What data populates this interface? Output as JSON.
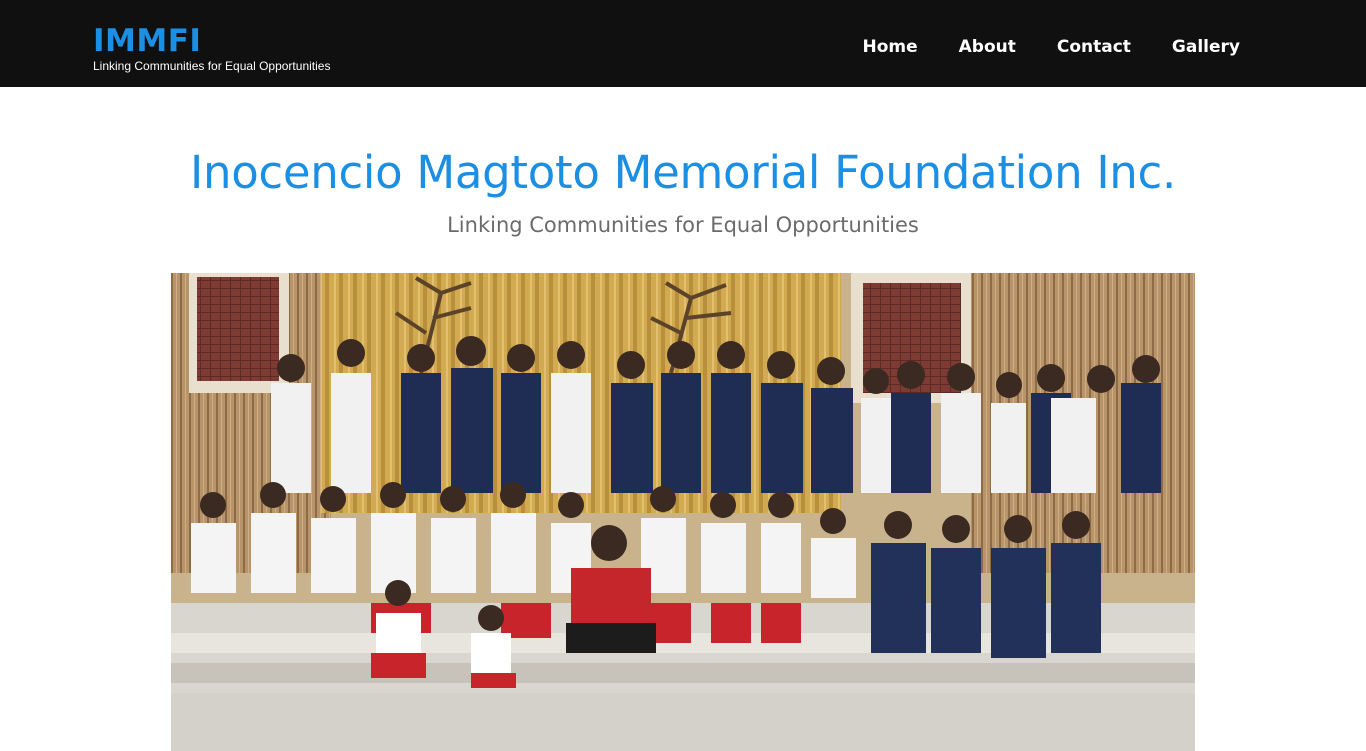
{
  "nav": {
    "brand_title": "IMMFI",
    "brand_tagline": "Linking Communities for Equal Opportunities",
    "links": [
      "Home",
      "About",
      "Contact",
      "Gallery"
    ]
  },
  "hero": {
    "title": "Inocencio Magtoto Memorial Foundation Inc.",
    "subtitle": "Linking Communities for Equal Opportunities"
  },
  "colors": {
    "nav_background": "#101010",
    "brand_accent": "#1a8fe3",
    "subtitle_gray": "#6b6b6b"
  }
}
